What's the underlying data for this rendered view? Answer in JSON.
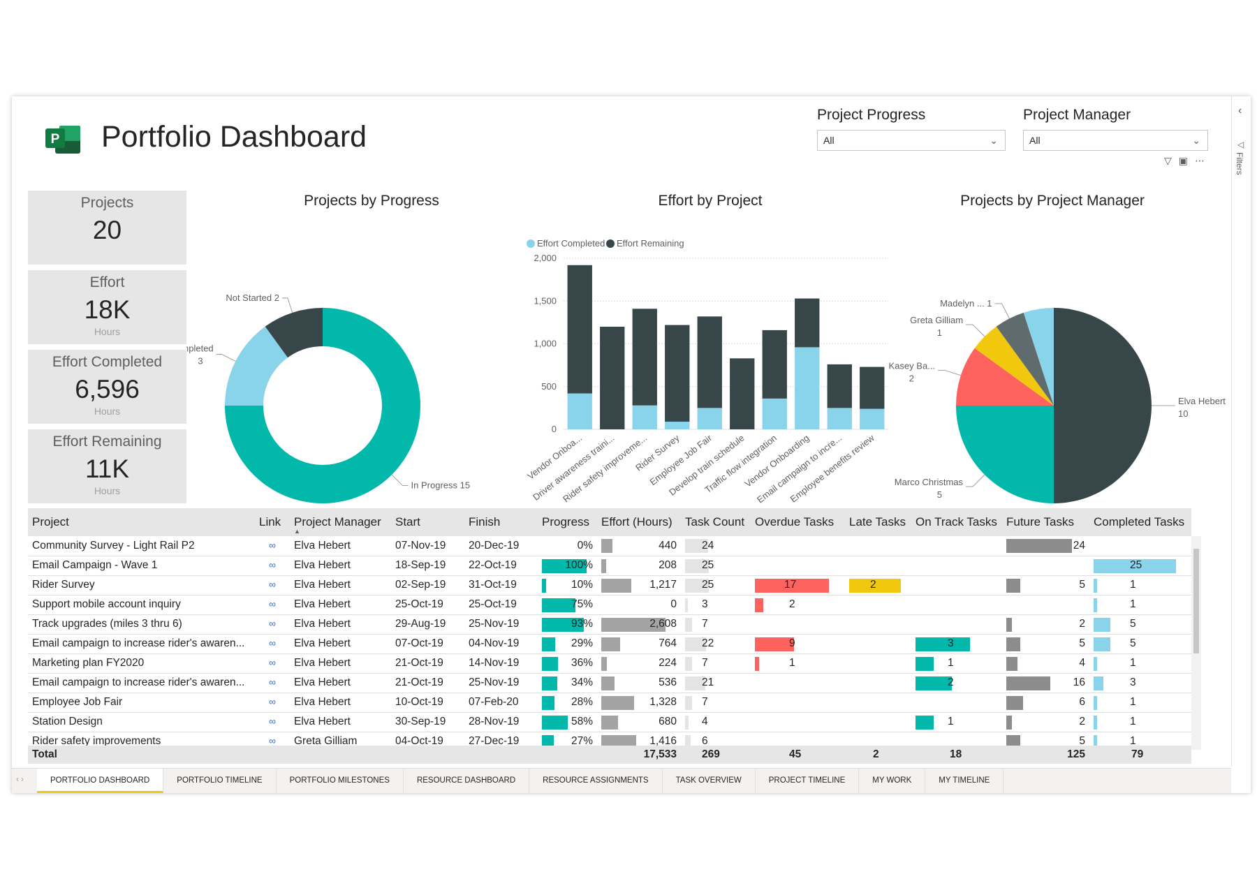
{
  "title": "Portfolio Dashboard",
  "app_icon": {
    "name": "project-logo-icon",
    "letter": "P",
    "color": "#31752f"
  },
  "slicers": [
    {
      "label": "Project Progress",
      "value": "All"
    },
    {
      "label": "Project Manager",
      "value": "All"
    }
  ],
  "filters_pane": {
    "label": "Filters"
  },
  "cards": [
    {
      "title": "Projects",
      "value": "20",
      "unit": ""
    },
    {
      "title": "Effort",
      "value": "18K",
      "unit": "Hours"
    },
    {
      "title": "Effort Completed",
      "value": "6,596",
      "unit": "Hours"
    },
    {
      "title": "Effort Remaining",
      "value": "11K",
      "unit": "Hours"
    }
  ],
  "chart_titles": {
    "progress": "Projects by Progress",
    "effort": "Effort by Project",
    "manager": "Projects by Project Manager"
  },
  "chart_data": [
    {
      "type": "pie",
      "variant": "donut",
      "title": "Projects by Progress",
      "slices": [
        {
          "label": "In Progress",
          "value": 15,
          "color": "#01b8aa"
        },
        {
          "label": "Completed",
          "value": 3,
          "color": "#8ad4eb"
        },
        {
          "label": "Not Started",
          "value": 2,
          "color": "#374649"
        }
      ]
    },
    {
      "type": "bar",
      "stacked": true,
      "title": "Effort by Project",
      "categories": [
        "Vendor Onboa...",
        "Driver awareness traini...",
        "Rider safety improveme...",
        "Rider Survey",
        "Employee Job Fair",
        "Develop train schedule",
        "Traffic flow integration",
        "Vendor Onboarding",
        "Email campaign to incre...",
        "Employee benefits review"
      ],
      "series": [
        {
          "name": "Effort Completed",
          "color": "#8ad4eb",
          "values": [
            420,
            0,
            280,
            90,
            250,
            0,
            360,
            960,
            250,
            240
          ]
        },
        {
          "name": "Effort Remaining",
          "color": "#374649",
          "values": [
            1500,
            1200,
            1130,
            1130,
            1070,
            830,
            800,
            570,
            510,
            490
          ]
        }
      ],
      "ylim": [
        0,
        2000
      ],
      "yticks": [
        "0",
        "500",
        "1,000",
        "1,500",
        "2,000"
      ],
      "legend_position": "top-left",
      "grid": true
    },
    {
      "type": "pie",
      "title": "Projects by Project Manager",
      "slices": [
        {
          "label": "Elva Hebert",
          "value": 10,
          "color": "#374649"
        },
        {
          "label": "Marco Christmas",
          "value": 5,
          "color": "#01b8aa"
        },
        {
          "label": "Kasey Ba...",
          "value": 2,
          "color": "#fd625e"
        },
        {
          "label": "Greta Gilliam",
          "value": 1,
          "color": "#f2c80f"
        },
        {
          "label": "Madelyn ...",
          "value": 1,
          "color": "#5f6b6d"
        },
        {
          "label": "",
          "value": 1,
          "color": "#8ad4eb"
        }
      ]
    }
  ],
  "table": {
    "columns": [
      "Project",
      "Link",
      "Project Manager",
      "Start",
      "Finish",
      "Progress",
      "Effort (Hours)",
      "Task Count",
      "Overdue Tasks",
      "Late Tasks",
      "On Track Tasks",
      "Future Tasks",
      "Completed Tasks"
    ],
    "rows": [
      {
        "project": "Community Survey - Light Rail P2",
        "manager": "Elva Hebert",
        "start": "07-Nov-19",
        "finish": "20-Dec-19",
        "progress": "0%",
        "p": 0,
        "effort": "440",
        "e": 440,
        "tasks": "24",
        "t": 24,
        "overdue": "",
        "o": 0,
        "late": "",
        "l": 0,
        "ontrack": "",
        "on": 0,
        "future": "24",
        "f": 24,
        "completed": "",
        "c": 0
      },
      {
        "project": "Email Campaign - Wave 1",
        "manager": "Elva Hebert",
        "start": "18-Sep-19",
        "finish": "22-Oct-19",
        "progress": "100%",
        "p": 100,
        "effort": "208",
        "e": 208,
        "tasks": "25",
        "t": 25,
        "overdue": "",
        "o": 0,
        "late": "",
        "l": 0,
        "ontrack": "",
        "on": 0,
        "future": "",
        "f": 0,
        "completed": "25",
        "c": 25
      },
      {
        "project": "Rider Survey",
        "manager": "Elva Hebert",
        "start": "02-Sep-19",
        "finish": "31-Oct-19",
        "progress": "10%",
        "p": 10,
        "effort": "1,217",
        "e": 1217,
        "tasks": "25",
        "t": 25,
        "overdue": "17",
        "o": 17,
        "late": "2",
        "l": 2,
        "ontrack": "",
        "on": 0,
        "future": "5",
        "f": 5,
        "completed": "1",
        "c": 1
      },
      {
        "project": "Support mobile account inquiry",
        "manager": "Elva Hebert",
        "start": "25-Oct-19",
        "finish": "25-Oct-19",
        "progress": "75%",
        "p": 75,
        "effort": "0",
        "e": 0,
        "tasks": "3",
        "t": 3,
        "overdue": "2",
        "o": 2,
        "late": "",
        "l": 0,
        "ontrack": "",
        "on": 0,
        "future": "",
        "f": 0,
        "completed": "1",
        "c": 1
      },
      {
        "project": "Track upgrades (miles 3 thru 6)",
        "manager": "Elva Hebert",
        "start": "29-Aug-19",
        "finish": "25-Nov-19",
        "progress": "93%",
        "p": 93,
        "effort": "2,608",
        "e": 2608,
        "tasks": "7",
        "t": 7,
        "overdue": "",
        "o": 0,
        "late": "",
        "l": 0,
        "ontrack": "",
        "on": 0,
        "future": "2",
        "f": 2,
        "completed": "5",
        "c": 5
      },
      {
        "project": "Email campaign to increase rider's awaren...",
        "manager": "Elva Hebert",
        "start": "07-Oct-19",
        "finish": "04-Nov-19",
        "progress": "29%",
        "p": 29,
        "effort": "764",
        "e": 764,
        "tasks": "22",
        "t": 22,
        "overdue": "9",
        "o": 9,
        "late": "",
        "l": 0,
        "ontrack": "3",
        "on": 3,
        "future": "5",
        "f": 5,
        "completed": "5",
        "c": 5
      },
      {
        "project": "Marketing plan FY2020",
        "manager": "Elva Hebert",
        "start": "21-Oct-19",
        "finish": "14-Nov-19",
        "progress": "36%",
        "p": 36,
        "effort": "224",
        "e": 224,
        "tasks": "7",
        "t": 7,
        "overdue": "1",
        "o": 1,
        "late": "",
        "l": 0,
        "ontrack": "1",
        "on": 1,
        "future": "4",
        "f": 4,
        "completed": "1",
        "c": 1
      },
      {
        "project": "Email campaign to increase rider's awaren...",
        "manager": "Elva Hebert",
        "start": "21-Oct-19",
        "finish": "25-Nov-19",
        "progress": "34%",
        "p": 34,
        "effort": "536",
        "e": 536,
        "tasks": "21",
        "t": 21,
        "overdue": "",
        "o": 0,
        "late": "",
        "l": 0,
        "ontrack": "2",
        "on": 2,
        "future": "16",
        "f": 16,
        "completed": "3",
        "c": 3
      },
      {
        "project": "Employee Job Fair",
        "manager": "Elva Hebert",
        "start": "10-Oct-19",
        "finish": "07-Feb-20",
        "progress": "28%",
        "p": 28,
        "effort": "1,328",
        "e": 1328,
        "tasks": "7",
        "t": 7,
        "overdue": "",
        "o": 0,
        "late": "",
        "l": 0,
        "ontrack": "",
        "on": 0,
        "future": "6",
        "f": 6,
        "completed": "1",
        "c": 1
      },
      {
        "project": "Station Design",
        "manager": "Elva Hebert",
        "start": "30-Sep-19",
        "finish": "28-Nov-19",
        "progress": "58%",
        "p": 58,
        "effort": "680",
        "e": 680,
        "tasks": "4",
        "t": 4,
        "overdue": "",
        "o": 0,
        "late": "",
        "l": 0,
        "ontrack": "1",
        "on": 1,
        "future": "2",
        "f": 2,
        "completed": "1",
        "c": 1
      },
      {
        "project": "Rider safety improvements",
        "manager": "Greta Gilliam",
        "start": "04-Oct-19",
        "finish": "27-Dec-19",
        "progress": "27%",
        "p": 27,
        "effort": "1,416",
        "e": 1416,
        "tasks": "6",
        "t": 6,
        "overdue": "",
        "o": 0,
        "late": "",
        "l": 0,
        "ontrack": "",
        "on": 0,
        "future": "5",
        "f": 5,
        "completed": "1",
        "c": 1
      }
    ],
    "total": {
      "label": "Total",
      "effort": "17,533",
      "tasks": "269",
      "overdue": "45",
      "late": "2",
      "ontrack": "18",
      "future": "125",
      "completed": "79"
    }
  },
  "tabs": [
    "PORTFOLIO DASHBOARD",
    "PORTFOLIO TIMELINE",
    "PORTFOLIO MILESTONES",
    "RESOURCE DASHBOARD",
    "RESOURCE ASSIGNMENTS",
    "TASK OVERVIEW",
    "PROJECT TIMELINE",
    "MY WORK",
    "MY TIMELINE"
  ],
  "active_tab": "PORTFOLIO DASHBOARD"
}
